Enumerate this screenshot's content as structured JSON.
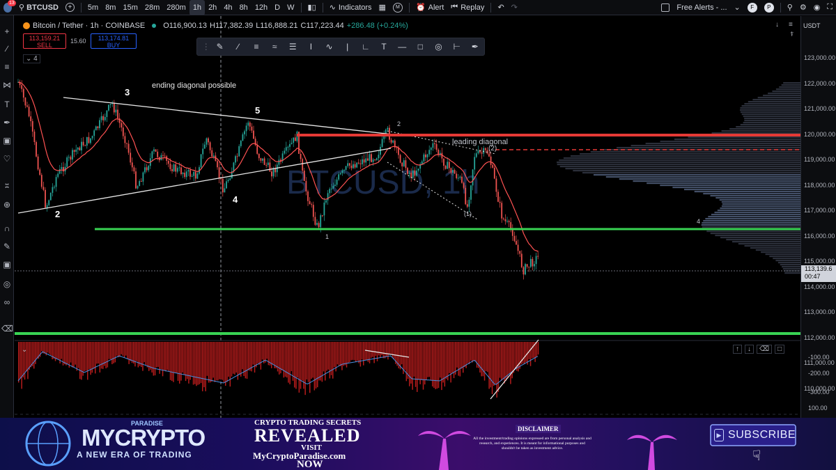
{
  "toolbar": {
    "symbol": "BTCUSD",
    "intervals": [
      "5m",
      "8m",
      "15m",
      "28m",
      "280m",
      "1h",
      "2h",
      "4h",
      "8h",
      "12h",
      "D",
      "W"
    ],
    "active_interval": "1h",
    "indicators_label": "Indicators",
    "alert_label": "Alert",
    "replay_label": "Replay",
    "free_alerts_label": "Free Alerts - ...",
    "badge_f": "F",
    "badge_p": "P",
    "notification_count": "13"
  },
  "legend": {
    "title": "Bitcoin / Tether · 1h · COINBASE",
    "open": "O116,900.13",
    "high": "H117,382.39",
    "low": "L116,888.21",
    "close": "C117,223.44",
    "change": "+286.48 (+0.24%)",
    "sell_price": "113,159.21",
    "sell_label": "SELL",
    "spread": "15.60",
    "buy_price": "113,174.81",
    "buy_label": "BUY",
    "indicator_count": "4"
  },
  "watermark": "BTCUSD, 1h",
  "currency": "USDT",
  "price_axis": [
    "123,000.00",
    "122,000.00",
    "121,000.00",
    "120,000.00",
    "119,000.00",
    "118,000.00",
    "117,000.00",
    "116,000.00",
    "115,000.00",
    "114,000.00",
    "113,000.00",
    "112,000.00",
    "111,000.00",
    "110,000.00"
  ],
  "current_price": "113,139.6",
  "countdown": "00:47",
  "osc_axis": [
    "-100.00",
    "-200.00",
    "-300.00",
    "100.00"
  ],
  "annotations": {
    "ending_diagonal": "ending diagonal possible",
    "leading_diagonal": "leading diagonal",
    "w2": "2",
    "w3": "3",
    "w4": "4",
    "w5": "5",
    "small_1": "1",
    "small_2": "2",
    "small_4": "4",
    "paren_1": "(1)",
    "paren_2": "(2)"
  },
  "colors": {
    "up": "#26a69a",
    "down": "#ef5350",
    "green_line": "#39d353",
    "red_line": "#e53935",
    "accent": "#2962ff"
  },
  "banner": {
    "brand_top": "PARADISE",
    "brand_main": "MYCRYPTO",
    "brand_tag": "A NEW ERA OF TRADING",
    "promo_line1": "CRYPTO TRADING SECRETS",
    "promo_line2": "REVEALED",
    "promo_line3": "VISIT",
    "promo_line4": "MyCryptoParadise.com",
    "promo_line5": "NOW",
    "disclaimer_title": "DISCLAIMER",
    "disclaimer_text": "All the investment/trading opinions expressed are from personal analysis and research, and experiences. It is meant for informational purposes and shouldn't be taken as investment advice.",
    "subscribe_label": "SUBSCRIBE"
  }
}
